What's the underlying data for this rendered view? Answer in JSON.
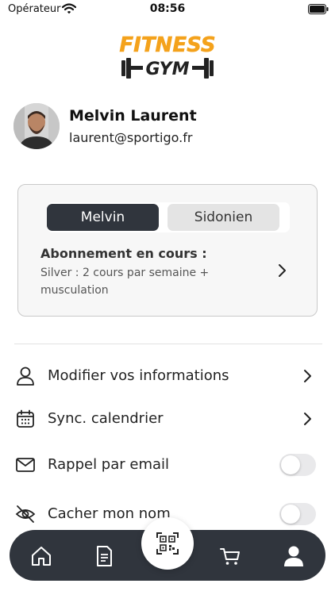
{
  "status_bar": {
    "carrier": "Opérateur",
    "time": "08:56"
  },
  "logo": {
    "line1": "FITNESS",
    "line2": "GYM"
  },
  "profile": {
    "name": "Melvin Laurent",
    "email": "laurent@sportigo.fr"
  },
  "subscription_card": {
    "members": [
      "Melvin",
      "Sidonien"
    ],
    "active_member": "Melvin",
    "title": "Abonnement en cours :",
    "description": "Silver : 2 cours par semaine + musculation"
  },
  "menu": [
    {
      "label": "Modifier vos informations",
      "icon": "user-icon",
      "control": "chevron"
    },
    {
      "label": "Sync. calendrier",
      "icon": "calendar-icon",
      "control": "chevron"
    },
    {
      "label": "Rappel par email",
      "icon": "mail-icon",
      "control": "toggle",
      "on": false
    },
    {
      "label": "Cacher mon nom",
      "icon": "eye-off-icon",
      "control": "toggle",
      "on": false
    }
  ],
  "tab_bar": {
    "items": [
      "home-icon",
      "document-icon",
      "qr-code-icon",
      "cart-icon",
      "profile-icon"
    ],
    "active": "profile-icon"
  },
  "colors": {
    "brand_orange": "#f4a21c",
    "dark": "#30353d",
    "card_bg": "#f7f7f7"
  }
}
